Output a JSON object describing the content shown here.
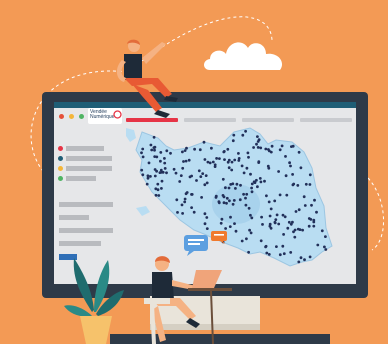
{
  "app": {
    "brand_name": "Vendée\nNumérique",
    "accent": "#E63446",
    "topbar_color": "#1F5E76"
  },
  "window_controls": [
    {
      "name": "red-dot",
      "color": "#E5513A"
    },
    {
      "name": "yellow-dot",
      "color": "#F4B63A"
    },
    {
      "name": "green-dot",
      "color": "#4FB463"
    }
  ],
  "legend": [
    {
      "color": "#E63446"
    },
    {
      "color": "#1F5E76"
    },
    {
      "color": "#F4B63A"
    },
    {
      "color": "#4FB463"
    }
  ],
  "map": {
    "fill": "#B9DDF2",
    "point_color": "#22305A"
  },
  "icons": [
    "cloud-icon",
    "chat-bubble-icon",
    "speech-bubble-icon",
    "plant-icon"
  ]
}
